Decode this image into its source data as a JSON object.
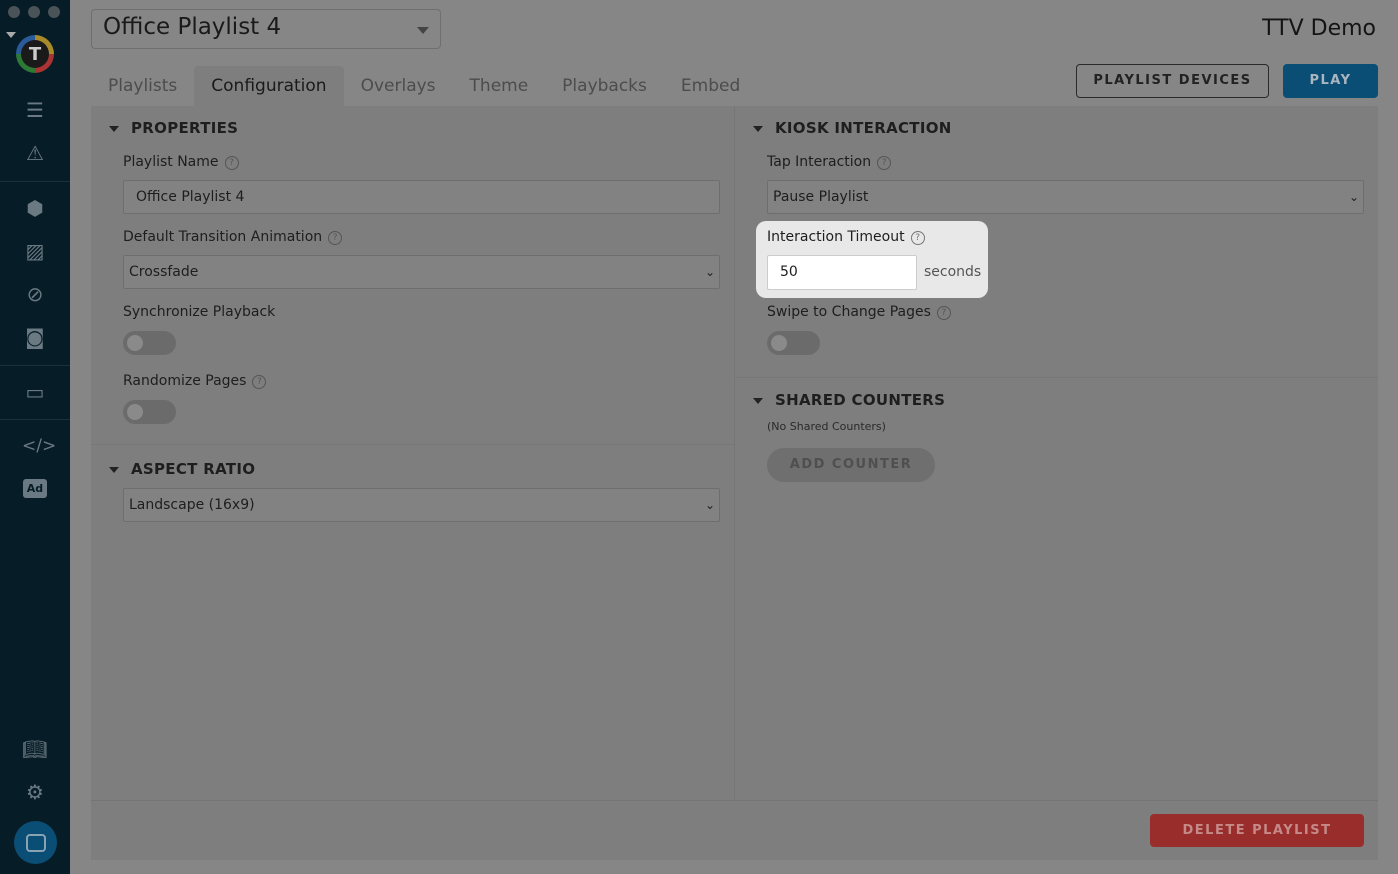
{
  "header": {
    "playlist_select": "Office Playlist 4",
    "org": "TTV Demo",
    "devices_btn": "PLAYLIST DEVICES",
    "play_btn": "PLAY"
  },
  "tabs": [
    "Playlists",
    "Configuration",
    "Overlays",
    "Theme",
    "Playbacks",
    "Embed"
  ],
  "logo": "T",
  "sidebar": {
    "icons": [
      "list-icon",
      "warning-icon",
      "cube-icon",
      "image-icon",
      "planet-icon",
      "camera-icon",
      "monitor-icon",
      "code-icon",
      "ad-icon",
      "book-icon",
      "gear-icon",
      "chat-icon"
    ],
    "ad_label": "Ad",
    "code_label": "</>"
  },
  "properties": {
    "title": "PROPERTIES",
    "name_label": "Playlist Name",
    "name_value": "Office Playlist 4",
    "transition_label": "Default Transition Animation",
    "transition_value": "Crossfade",
    "sync_label": "Synchronize Playback",
    "sync_on": false,
    "random_label": "Randomize Pages",
    "random_on": false
  },
  "aspect": {
    "title": "ASPECT RATIO",
    "value": "Landscape (16x9)"
  },
  "kiosk": {
    "title": "KIOSK INTERACTION",
    "tap_label": "Tap Interaction",
    "tap_value": "Pause Playlist",
    "timeout_label": "Interaction Timeout",
    "timeout_value": "50",
    "timeout_unit": "seconds",
    "swipe_label": "Swipe to Change Pages",
    "swipe_on": false
  },
  "counters": {
    "title": "SHARED COUNTERS",
    "empty": "(No Shared Counters)",
    "add_btn": "ADD COUNTER"
  },
  "footer": {
    "delete_btn": "DELETE PLAYLIST"
  },
  "help_glyph": "?",
  "chevron": "⌄"
}
